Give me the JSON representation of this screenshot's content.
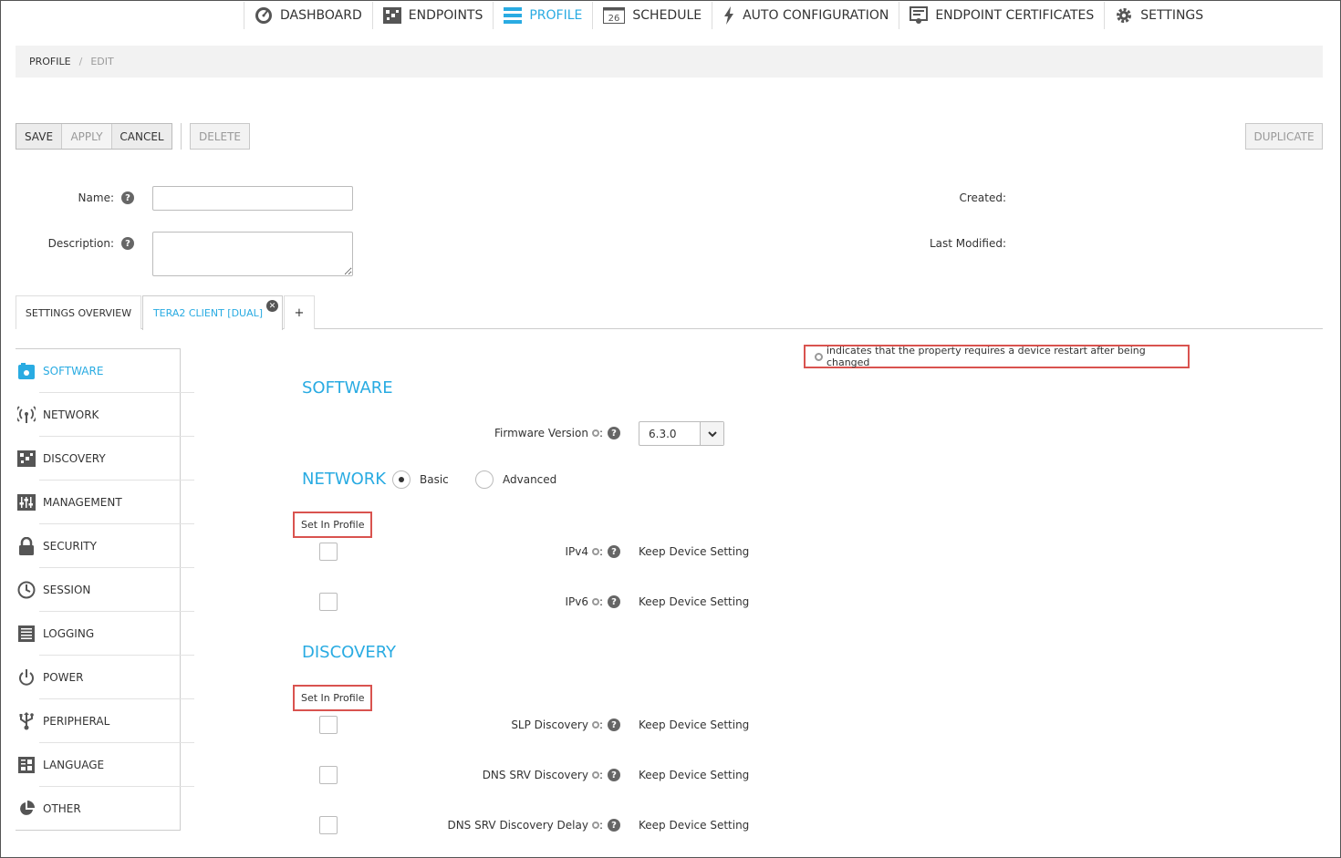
{
  "nav": {
    "items": [
      {
        "label": "DASHBOARD",
        "icon": "dashboard-icon"
      },
      {
        "label": "ENDPOINTS",
        "icon": "endpoints-icon"
      },
      {
        "label": "PROFILE",
        "icon": "profile-icon",
        "active": true
      },
      {
        "label": "SCHEDULE",
        "icon": "calendar-icon",
        "badge": "26"
      },
      {
        "label": "AUTO CONFIGURATION",
        "icon": "lightning-icon"
      },
      {
        "label": "ENDPOINT CERTIFICATES",
        "icon": "certificate-icon"
      },
      {
        "label": "SETTINGS",
        "icon": "gear-icon"
      }
    ]
  },
  "breadcrumb": {
    "root": "PROFILE",
    "separator": "/",
    "current": "EDIT"
  },
  "toolbar": {
    "save": "SAVE",
    "apply": "APPLY",
    "cancel": "CANCEL",
    "delete": "DELETE",
    "duplicate": "DUPLICATE"
  },
  "form": {
    "name_label": "Name:",
    "name_value": "",
    "description_label": "Description:",
    "description_value": "",
    "created_label": "Created:",
    "modified_label": "Last Modified:",
    "help_glyph": "?"
  },
  "tabs": [
    {
      "label": "SETTINGS OVERVIEW"
    },
    {
      "label": "TERA2 CLIENT [DUAL]",
      "active": true,
      "closable": true
    },
    {
      "label": "+"
    }
  ],
  "sidebar": {
    "items": [
      {
        "label": "SOFTWARE",
        "icon": "software-icon",
        "active": true
      },
      {
        "label": "NETWORK",
        "icon": "network-icon"
      },
      {
        "label": "DISCOVERY",
        "icon": "discovery-icon"
      },
      {
        "label": "MANAGEMENT",
        "icon": "management-icon"
      },
      {
        "label": "SECURITY",
        "icon": "lock-icon"
      },
      {
        "label": "SESSION",
        "icon": "clock-icon"
      },
      {
        "label": "LOGGING",
        "icon": "logging-icon"
      },
      {
        "label": "POWER",
        "icon": "power-icon"
      },
      {
        "label": "PERIPHERAL",
        "icon": "usb-icon"
      },
      {
        "label": "LANGUAGE",
        "icon": "language-icon"
      },
      {
        "label": "OTHER",
        "icon": "pie-chart-icon"
      }
    ]
  },
  "content": {
    "restart_note": "indicates that the property requires a device restart after being changed",
    "software": {
      "title": "SOFTWARE",
      "firmware_label": "Firmware Version",
      "firmware_value": "6.3.0"
    },
    "network": {
      "title": "NETWORK",
      "mode_basic": "Basic",
      "mode_advanced": "Advanced",
      "mode_selected": "Basic",
      "set_in_profile": "Set In Profile",
      "properties": [
        {
          "label": "IPv4",
          "value": "Keep Device Setting"
        },
        {
          "label": "IPv6",
          "value": "Keep Device Setting"
        }
      ]
    },
    "discovery": {
      "title": "DISCOVERY",
      "set_in_profile": "Set In Profile",
      "properties": [
        {
          "label": "SLP Discovery",
          "value": "Keep Device Setting"
        },
        {
          "label": "DNS SRV Discovery",
          "value": "Keep Device Setting"
        },
        {
          "label": "DNS SRV Discovery Delay",
          "value": "Keep Device Setting"
        }
      ]
    },
    "colon": ":"
  },
  "colors": {
    "accent": "#29abe2",
    "highlight": "#d9534f"
  }
}
